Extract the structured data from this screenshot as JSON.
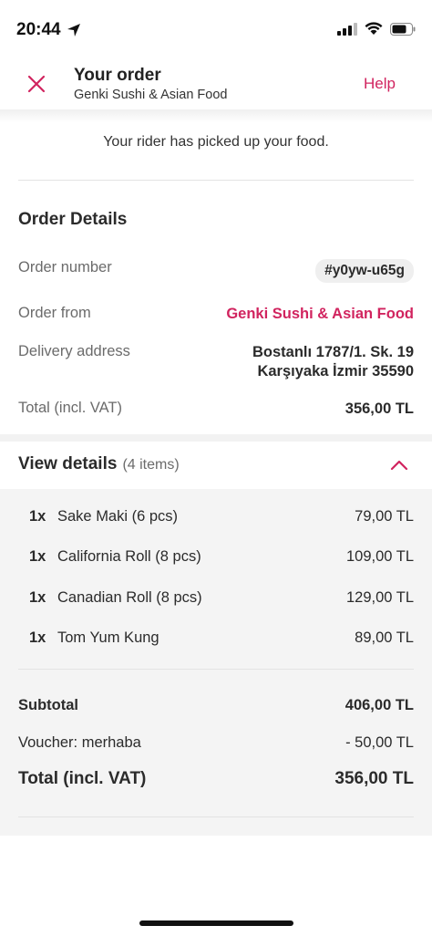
{
  "status_bar": {
    "time": "20:44",
    "icons": [
      "location-arrow-icon",
      "cellular-signal-icon",
      "wifi-icon",
      "battery-icon"
    ]
  },
  "header": {
    "title": "Your order",
    "subtitle": "Genki Sushi & Asian Food",
    "help_label": "Help",
    "accent_color": "#d1245f"
  },
  "status_message": "Your rider has picked up your food.",
  "order_details": {
    "title": "Order Details",
    "order_number_label": "Order number",
    "order_number": "#y0yw-u65g",
    "order_from_label": "Order from",
    "order_from": "Genki Sushi & Asian Food",
    "delivery_address_label": "Delivery address",
    "address_line1": "Bostanlı 1787/1. Sk. 19",
    "address_line2": "Karşıyaka İzmir 35590",
    "total_label": "Total (incl. VAT)",
    "total_value": "356,00 TL"
  },
  "view_details": {
    "label": "View details",
    "count": "(4 items)",
    "expanded": true
  },
  "items": [
    {
      "qty": "1x",
      "name": "Sake Maki (6 pcs)",
      "price": "79,00 TL"
    },
    {
      "qty": "1x",
      "name": "California Roll (8 pcs)",
      "price": "109,00 TL"
    },
    {
      "qty": "1x",
      "name": "Canadian Roll (8 pcs)",
      "price": "129,00 TL"
    },
    {
      "qty": "1x",
      "name": "Tom Yum Kung",
      "price": "89,00 TL"
    }
  ],
  "summary": {
    "subtotal_label": "Subtotal",
    "subtotal_value": "406,00 TL",
    "voucher_label": "Voucher: merhaba",
    "voucher_value": "- 50,00 TL",
    "total_label": "Total (incl. VAT)",
    "total_value": "356,00 TL"
  }
}
